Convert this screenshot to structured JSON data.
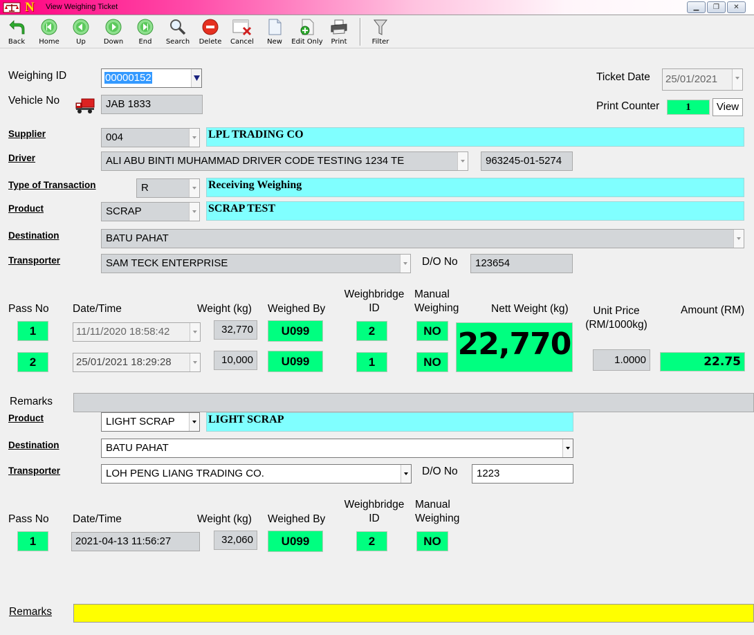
{
  "window": {
    "title": "View Weighing Ticket"
  },
  "toolbar": [
    {
      "id": "back",
      "label": "Back",
      "icon": "back-arrow-icon"
    },
    {
      "id": "home",
      "label": "Home",
      "icon": "home-icon"
    },
    {
      "id": "up",
      "label": "Up",
      "icon": "up-arrow-icon"
    },
    {
      "id": "down",
      "label": "Down",
      "icon": "down-arrow-icon"
    },
    {
      "id": "end",
      "label": "End",
      "icon": "end-icon"
    },
    {
      "id": "search",
      "label": "Search",
      "icon": "magnifier-icon"
    },
    {
      "id": "delete",
      "label": "Delete",
      "icon": "delete-icon"
    },
    {
      "id": "cancel",
      "label": "Cancel",
      "icon": "cancel-icon"
    },
    {
      "id": "new",
      "label": "New",
      "icon": "new-document-icon"
    },
    {
      "id": "edit_only",
      "label": "Edit Only",
      "icon": "edit-icon"
    },
    {
      "id": "print",
      "label": "Print",
      "icon": "printer-icon"
    },
    {
      "id": "filter",
      "label": "Filter",
      "icon": "funnel-icon"
    }
  ],
  "header": {
    "weighing_id_label": "Weighing ID",
    "weighing_id": "00000152",
    "vehicle_no_label": "Vehicle No",
    "vehicle_no": "JAB 1833",
    "ticket_date_label": "Ticket Date",
    "ticket_date": "25/01/2021",
    "print_counter_label": "Print Counter",
    "print_counter": "1",
    "view_label": "View"
  },
  "details": {
    "supplier_label": "Supplier",
    "supplier_code": "004",
    "supplier_name": "LPL TRADING CO",
    "driver_label": "Driver",
    "driver_name": "ALI ABU BINTI MUHAMMAD DRIVER CODE TESTING 1234 TE",
    "driver_ic": "963245-01-5274",
    "transaction_label": "Type of Transaction",
    "transaction_code": "R",
    "transaction_name": "Receiving Weighing",
    "product_label": "Product",
    "product_code": "SCRAP",
    "product_name": "SCRAP TEST",
    "destination_label": "Destination",
    "destination": "BATU PAHAT",
    "transporter_label": "Transporter",
    "transporter": "SAM TECK ENTERPRISE",
    "do_label": "D/O No",
    "do_no": "123654"
  },
  "columns": {
    "pass_no": "Pass No",
    "datetime": "Date/Time",
    "weight": "Weight (kg)",
    "weighed_by": "Weighed By",
    "weighbridge_1": "Weighbridge",
    "weighbridge_2": "ID",
    "manual_1": "Manual",
    "manual_2": "Weighing",
    "nett_weight": "Nett Weight (kg)",
    "unit_price_1": "Unit Price",
    "unit_price_2": "(RM/1000kg)",
    "amount": "Amount (RM)"
  },
  "passes": [
    {
      "pass": "1",
      "datetime": "11/11/2020 18:58:42",
      "weight": "32,770",
      "by": "U099",
      "bridge": "2",
      "manual": "NO"
    },
    {
      "pass": "2",
      "datetime": "25/01/2021 18:29:28",
      "weight": "10,000",
      "by": "U099",
      "bridge": "1",
      "manual": "NO"
    }
  ],
  "nett_weight": "22,770",
  "unit_price": "1.0000",
  "amount": "22.75",
  "remarks_label": "Remarks",
  "remarks": "",
  "second": {
    "product_label": "Product",
    "product_code": "LIGHT SCRAP",
    "product_name": "LIGHT SCRAP",
    "destination_label": "Destination",
    "destination": "BATU PAHAT",
    "transporter_label": "Transporter",
    "transporter": "LOH PENG LIANG TRADING CO.",
    "do_label": "D/O No",
    "do_no": "1223",
    "pass": {
      "pass": "1",
      "datetime": "2021-04-13 11:56:27",
      "weight": "32,060",
      "by": "U099",
      "bridge": "2",
      "manual": "NO"
    },
    "remarks_label": "Remarks",
    "remarks": ""
  },
  "colors": {
    "accent_green": "#00ff80",
    "cyan_field": "#80ffff",
    "remarks_yellow": "#ffff00",
    "title_pink": "#ff007f"
  }
}
